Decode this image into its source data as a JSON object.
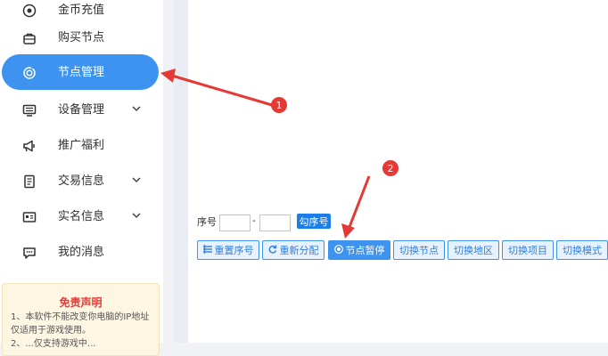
{
  "sidebar": {
    "items": [
      {
        "label": "金币充值",
        "icon": "coin-icon"
      },
      {
        "label": "购买节点",
        "icon": "bag-icon"
      },
      {
        "label": "节点管理",
        "icon": "node-icon",
        "active": true
      },
      {
        "label": "设备管理",
        "icon": "device-icon",
        "expandable": true
      },
      {
        "label": "推广福利",
        "icon": "megaphone-icon"
      },
      {
        "label": "交易信息",
        "icon": "document-icon",
        "expandable": true
      },
      {
        "label": "实名信息",
        "icon": "id-card-icon",
        "expandable": true
      },
      {
        "label": "我的消息",
        "icon": "message-icon"
      }
    ],
    "active_color": "#3e93f0"
  },
  "notice": {
    "title": "免责声明",
    "line1": "1、本软件不能改变你电脑的IP地址",
    "line2": "仅适用于游戏使用。",
    "line3": "2、...仅支持游戏中..."
  },
  "toolbar": {
    "seq_label": "序号",
    "dash": "-",
    "check_label": "勾序号",
    "reset_label": "重置序号",
    "realloc_label": "重新分配",
    "pause_label": "节点暂停",
    "switch_node_label": "切换节点",
    "switch_region_label": "切换地区",
    "switch_project_label": "切换项目",
    "switch_mode_label": "切换模式"
  },
  "markers": {
    "one": "1",
    "two": "2"
  },
  "colors": {
    "accent": "#3e93f0",
    "marker": "#e53935"
  }
}
